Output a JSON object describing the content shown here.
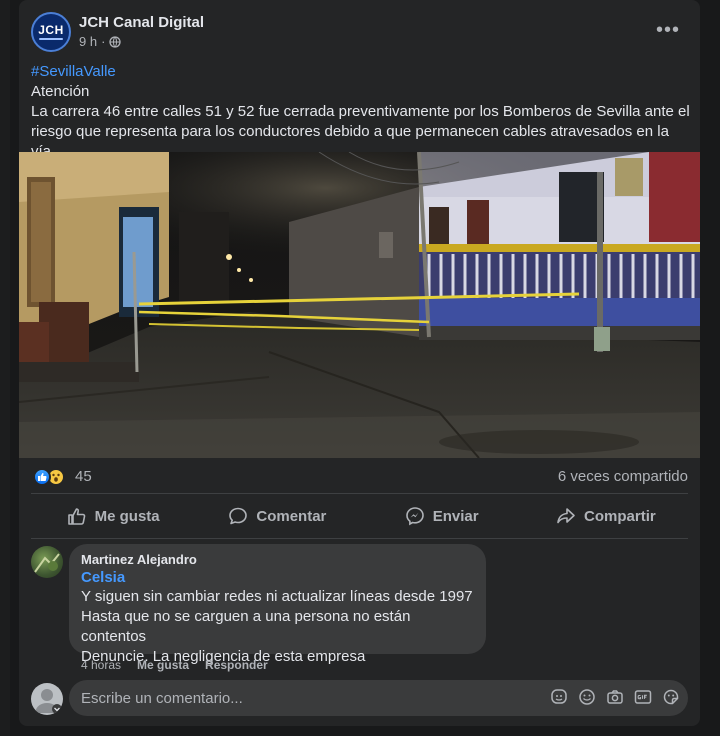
{
  "post": {
    "page_name": "JCH Canal Digital",
    "avatar_text": "JCH",
    "time": "9 h",
    "separator": "·",
    "more": "•••",
    "hashtag": "#SevillaValle",
    "heading": "Atención",
    "body": "La carrera 46  entre calles 51 y 52 fue cerrada preventivamente por los Bomberos de Sevilla ante el riesgo que representa para los conductores debido a que permanecen cables atravesados en la vía."
  },
  "stats": {
    "reaction_count": "45",
    "shares": "6 veces compartido"
  },
  "actions": {
    "like": "Me gusta",
    "comment": "Comentar",
    "send": "Enviar",
    "share": "Compartir"
  },
  "comment": {
    "author": "Martinez Alejandro",
    "tag": "Celsia",
    "lines": [
      "Y siguen sin cambiar redes ni actualizar líneas desde 1997",
      "Hasta que no se carguen a una persona no están contentos",
      "Denuncie. La negligencia de esta empresa"
    ],
    "time": "4 horas",
    "like": "Me gusta",
    "reply": "Responder"
  },
  "composer": {
    "placeholder": "Escribe un comentario..."
  },
  "icons": {
    "privacy": "globe-icon",
    "like": "thumbs-up-icon",
    "comment": "speech-bubble-icon",
    "send": "messenger-icon",
    "share": "share-arrow-icon",
    "composer": [
      "avatar-sticker-icon",
      "emoji-icon",
      "camera-icon",
      "gif-icon",
      "sticker-icon"
    ]
  },
  "colors": {
    "background": "#18191a",
    "card": "#242526",
    "bubble": "#3a3b3c",
    "link": "#4599ff",
    "like_blue": "#0a6ef0",
    "wow_yellow": "#f7c843",
    "caution_tape": "#e6d23a"
  }
}
